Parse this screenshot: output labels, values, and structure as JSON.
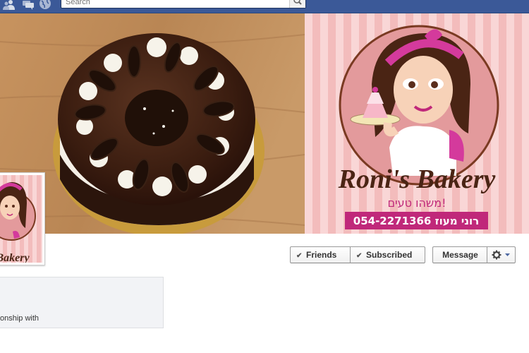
{
  "topbar": {
    "icons": [
      "friend-requests-icon",
      "messages-icon",
      "notifications-globe-icon"
    ],
    "search": {
      "placeholder": "Search",
      "value": ""
    }
  },
  "cover": {
    "logo_title": "Roni's Bakery",
    "logo_slogan": "משהו טעים!",
    "contact": "054-2271366 רוני מעוז"
  },
  "profile": {
    "logo_text": "Bakery"
  },
  "actions": {
    "friends_label": "Friends",
    "subscribed_label": "Subscribed",
    "message_label": "Message"
  },
  "about": {
    "relationship_text": "onship with"
  },
  "colors": {
    "topbar": "#3b5998",
    "brand_magenta": "#c02e8c",
    "brand_brown": "#5a2d1c"
  }
}
